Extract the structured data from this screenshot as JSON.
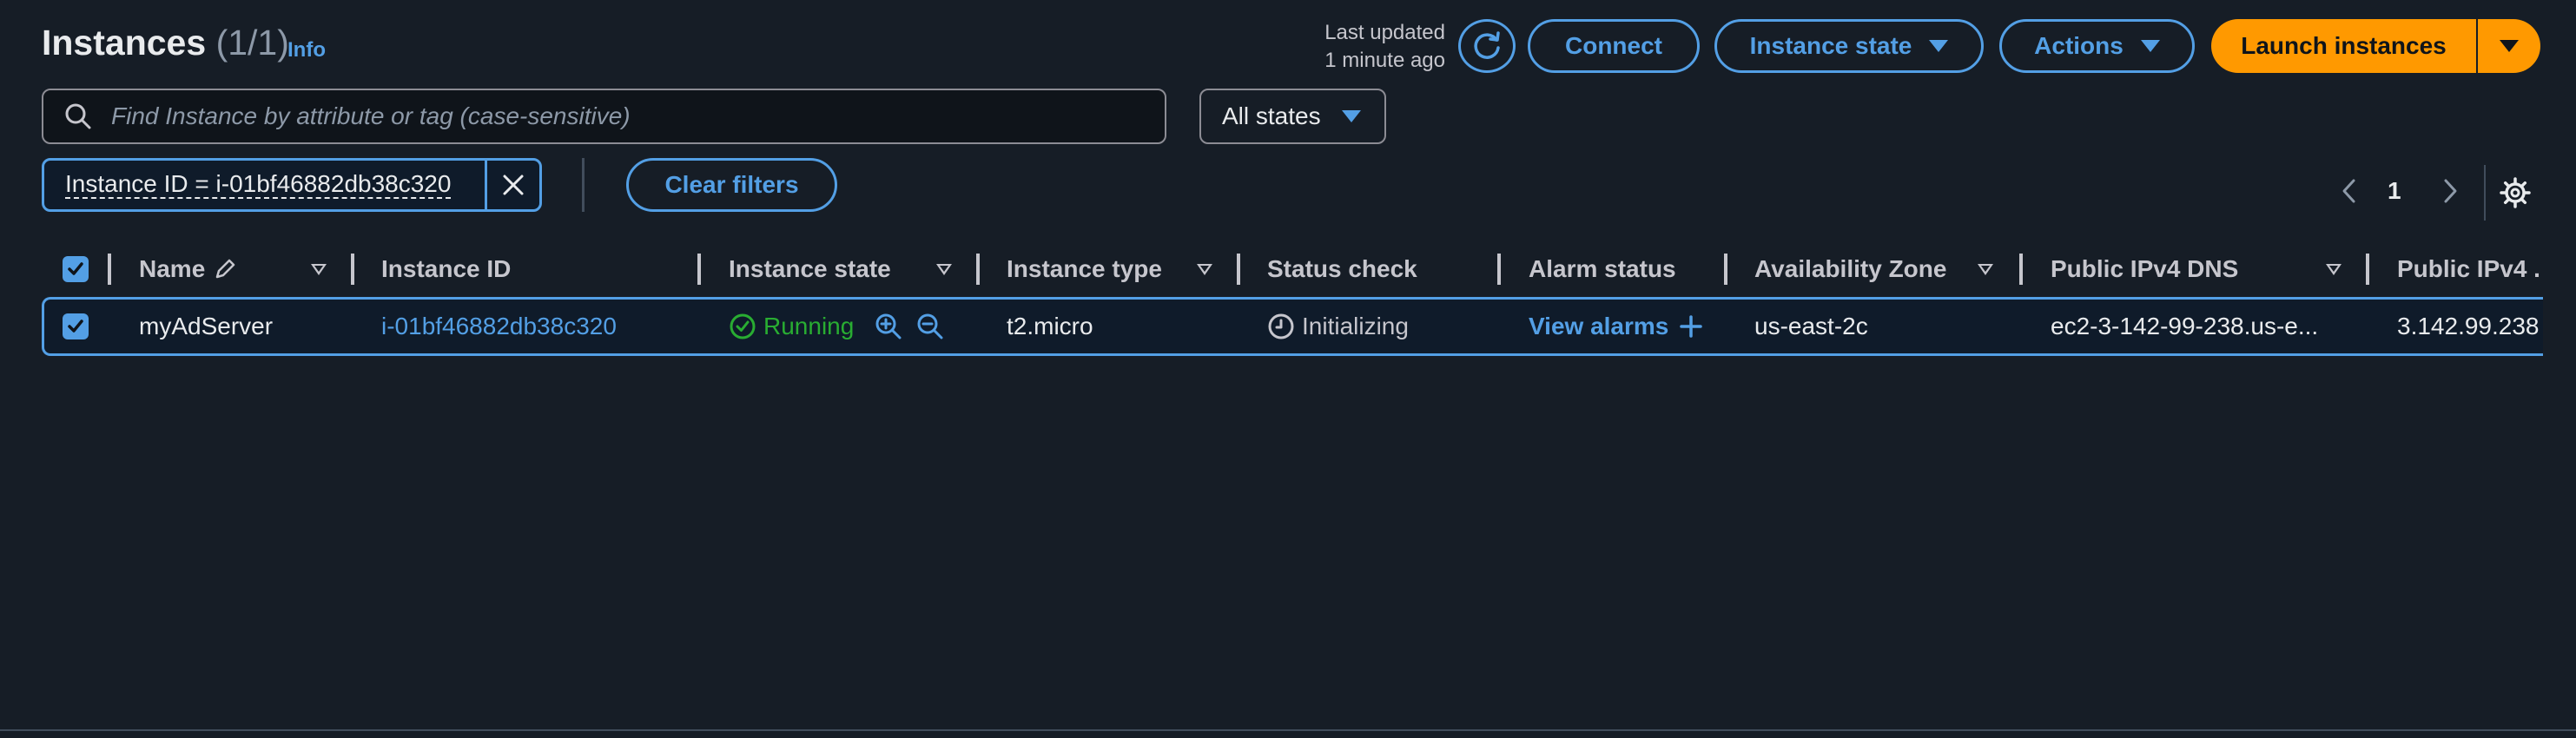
{
  "header": {
    "title": "Instances",
    "count": "(1/1)",
    "info_label": "Info",
    "last_updated_line1": "Last updated",
    "last_updated_line2": "1 minute ago",
    "connect_label": "Connect",
    "instance_state_label": "Instance state",
    "actions_label": "Actions",
    "launch_label": "Launch instances"
  },
  "search": {
    "placeholder": "Find Instance by attribute or tag (case-sensitive)",
    "states_filter": "All states"
  },
  "filters": {
    "token_label": "Instance ID = i-01bf46882db38c320",
    "clear_label": "Clear filters"
  },
  "pagination": {
    "current_page": "1"
  },
  "table": {
    "columns": {
      "name": "Name",
      "instance_id": "Instance ID",
      "instance_state": "Instance state",
      "instance_type": "Instance type",
      "status_check": "Status check",
      "alarm_status": "Alarm status",
      "availability_zone": "Availability Zone",
      "public_dns": "Public IPv4 DNS",
      "public_ip": "Public IPv4 ..."
    },
    "rows": [
      {
        "selected": true,
        "name": "myAdServer",
        "instance_id": "i-01bf46882db38c320",
        "instance_state": "Running",
        "instance_type": "t2.micro",
        "status_check": "Initializing",
        "alarm_status": "View alarms",
        "availability_zone": "us-east-2c",
        "public_dns": "ec2-3-142-99-238.us-e...",
        "public_ip": "3.142.99.238"
      }
    ]
  },
  "colors": {
    "background": "#161d26",
    "accent": "#539fe5",
    "primary_button": "#ff9900",
    "success": "#29ad32"
  }
}
